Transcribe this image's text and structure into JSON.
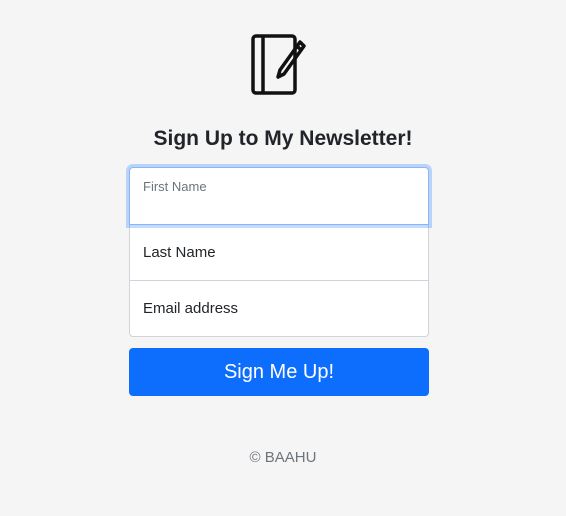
{
  "logo": {
    "icon": "notebook-pen-icon"
  },
  "heading": "Sign Up to My Newsletter!",
  "form": {
    "first_name": {
      "label": "First Name",
      "value": ""
    },
    "last_name": {
      "placeholder": "Last Name",
      "value": ""
    },
    "email": {
      "placeholder": "Email address",
      "value": ""
    },
    "submit_label": "Sign Me Up!"
  },
  "footer": "© BAAHU",
  "colors": {
    "background": "#f5f5f5",
    "primary": "#0d6efd",
    "focus_border": "#86b7fe",
    "border": "#ced4da",
    "muted_text": "#6c757d",
    "text": "#212529"
  }
}
